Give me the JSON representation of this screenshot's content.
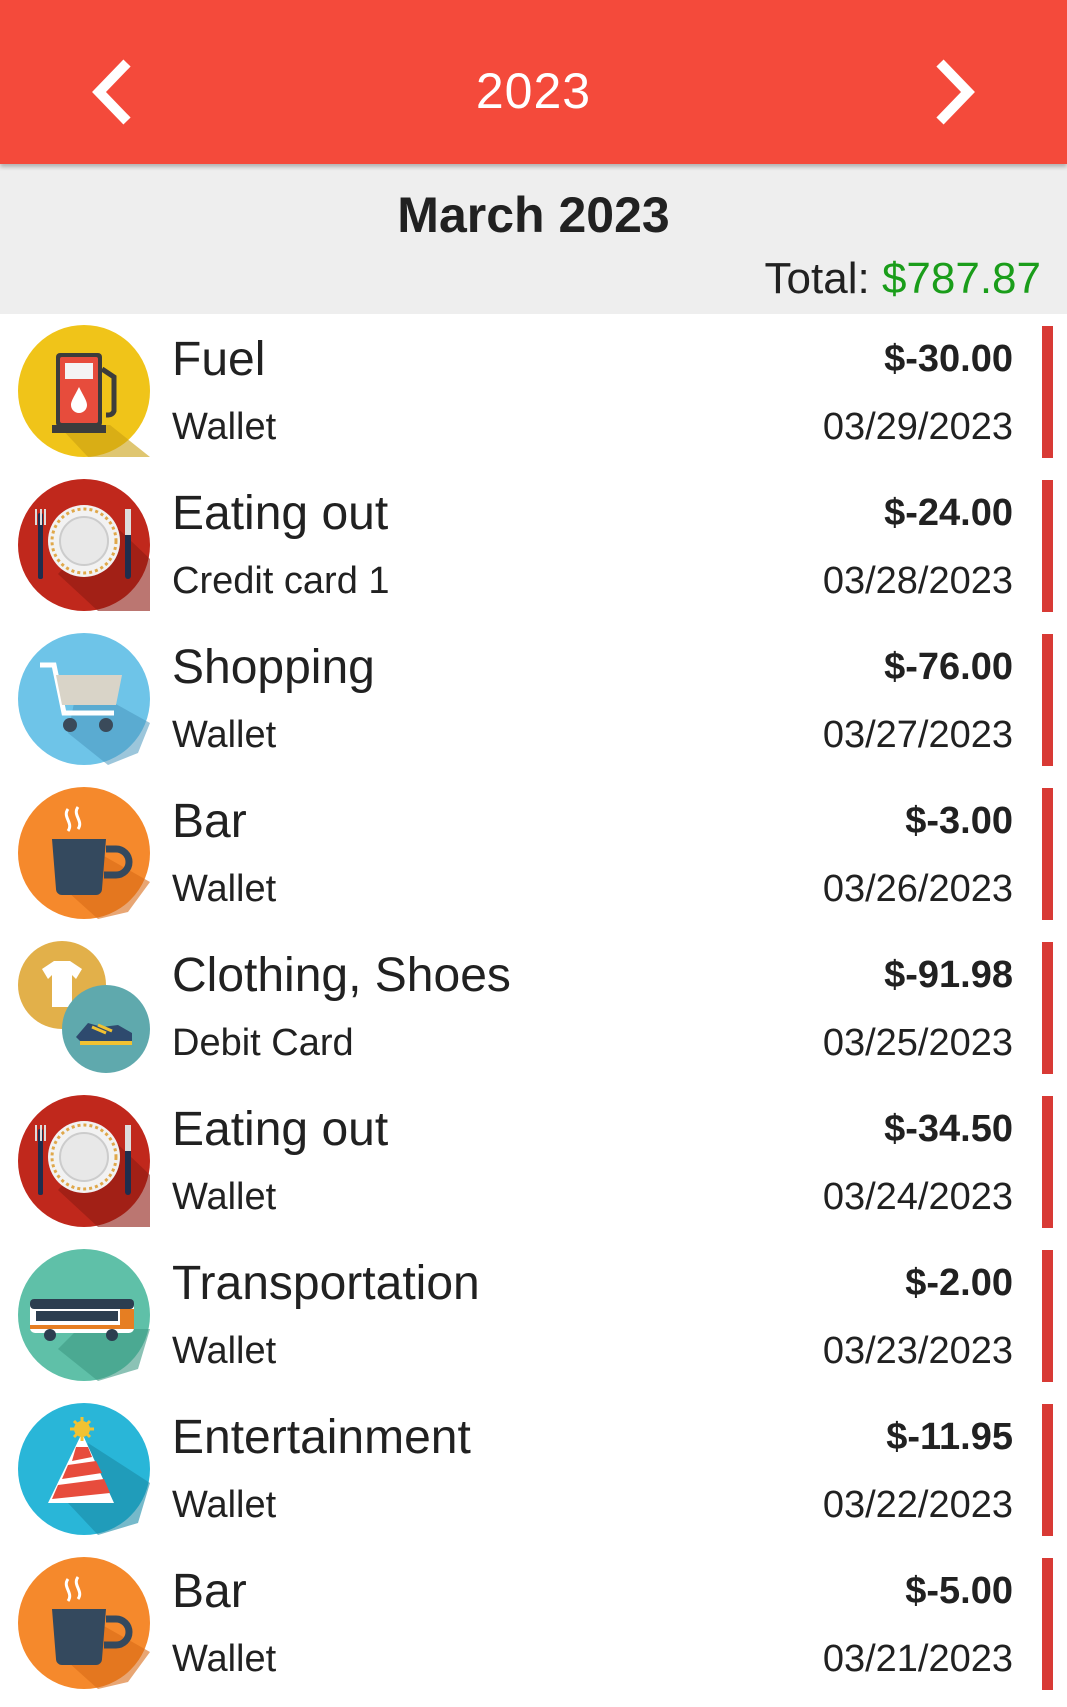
{
  "header": {
    "year": "2023",
    "accent_color": "#f44a3b",
    "prev_icon": "chevron-left-icon",
    "next_icon": "chevron-right-icon"
  },
  "summary": {
    "month": "March 2023",
    "total_label": "Total:",
    "total_value": "$787.87",
    "total_color": "#1a9d1a"
  },
  "transactions": [
    {
      "category": "Fuel",
      "account": "Wallet",
      "amount": "$-30.00",
      "date": "03/29/2023",
      "icon": "fuel-pump-icon"
    },
    {
      "category": "Eating out",
      "account": "Credit card 1",
      "amount": "$-24.00",
      "date": "03/28/2023",
      "icon": "plate-cutlery-icon"
    },
    {
      "category": "Shopping",
      "account": "Wallet",
      "amount": "$-76.00",
      "date": "03/27/2023",
      "icon": "shopping-cart-icon"
    },
    {
      "category": "Bar",
      "account": "Wallet",
      "amount": "$-3.00",
      "date": "03/26/2023",
      "icon": "coffee-cup-icon"
    },
    {
      "category": "Clothing, Shoes",
      "account": "Debit Card",
      "amount": "$-91.98",
      "date": "03/25/2023",
      "icon": "tshirt-shoe-icon"
    },
    {
      "category": "Eating out",
      "account": "Wallet",
      "amount": "$-34.50",
      "date": "03/24/2023",
      "icon": "plate-cutlery-icon"
    },
    {
      "category": "Transportation",
      "account": "Wallet",
      "amount": "$-2.00",
      "date": "03/23/2023",
      "icon": "bus-icon"
    },
    {
      "category": "Entertainment",
      "account": "Wallet",
      "amount": "$-11.95",
      "date": "03/22/2023",
      "icon": "party-hat-icon"
    },
    {
      "category": "Bar",
      "account": "Wallet",
      "amount": "$-5.00",
      "date": "03/21/2023",
      "icon": "coffee-cup-icon"
    }
  ],
  "expense_marker_color": "#d83a35"
}
